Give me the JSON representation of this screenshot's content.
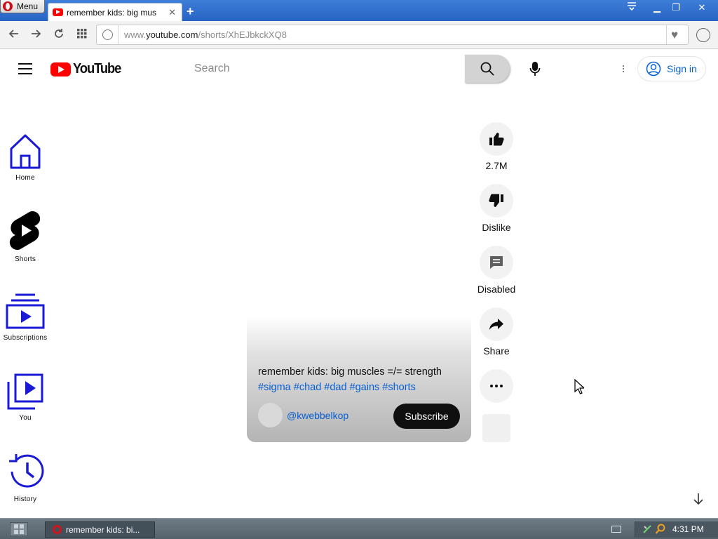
{
  "browser": {
    "menu_label": "Menu",
    "tab_title": "remember kids: big mus",
    "tab_close": "✕",
    "new_tab": "+",
    "url_prefix": "www.",
    "url_domain": "youtube.com",
    "url_path": "/shorts/XhEJbkckXQ8",
    "controls": {
      "minimize": "▁",
      "restore": "❐",
      "close": "✕"
    }
  },
  "youtube": {
    "logo_text": "YouTube",
    "search_placeholder": "Search",
    "sign_in": "Sign in"
  },
  "guide": {
    "items": [
      {
        "label": "Home"
      },
      {
        "label": "Shorts"
      },
      {
        "label": "Subscriptions"
      },
      {
        "label": "You"
      },
      {
        "label": "History"
      }
    ]
  },
  "short": {
    "title": "remember kids: big muscles =/= strength",
    "hashtags": [
      "#sigma",
      "#chad",
      "#dad",
      "#gains",
      "#shorts"
    ],
    "channel": "@kwebbelkop",
    "subscribe": "Subscribe"
  },
  "actions": {
    "like_count": "2.7M",
    "dislike": "Dislike",
    "comments": "Disabled",
    "share": "Share"
  },
  "taskbar": {
    "task_title": "remember kids: bi...",
    "clock": "4:31 PM"
  },
  "colors": {
    "youtube_red": "#ff0000",
    "link_blue": "#065fd4",
    "guide_icon": "#1a1ad6",
    "titlebar_blue": "#2f6fd0"
  }
}
